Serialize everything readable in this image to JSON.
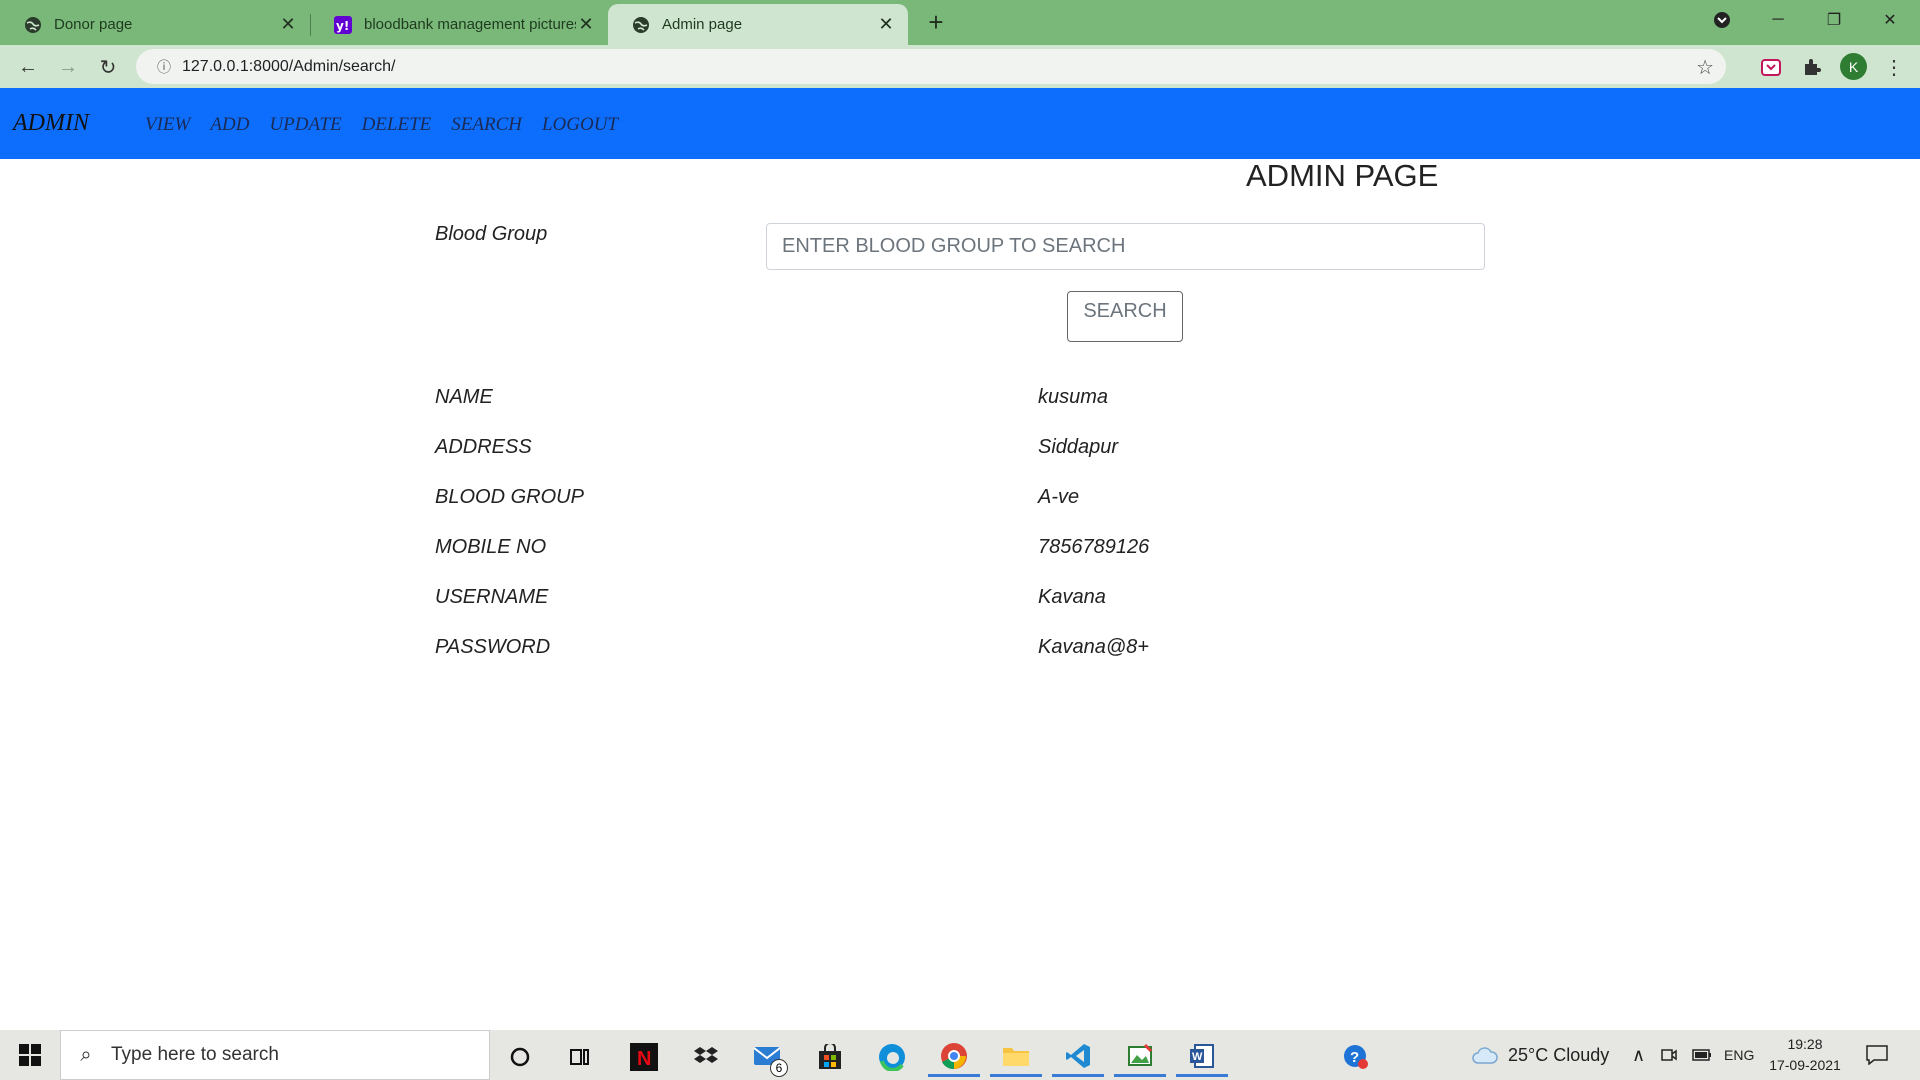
{
  "browser": {
    "tabs": [
      {
        "title": "Donor page",
        "icon": "globe-icon",
        "active": false
      },
      {
        "title": "bloodbank management pictures",
        "icon": "yahoo-icon",
        "active": false
      },
      {
        "title": "Admin page",
        "icon": "globe-icon",
        "active": true
      }
    ],
    "url": "127.0.0.1:8000/Admin/search/",
    "profile_initial": "K"
  },
  "navbar": {
    "brand": "ADMIN",
    "links": [
      "VIEW",
      "ADD",
      "UPDATE",
      "DELETE",
      "SEARCH",
      "LOGOUT"
    ],
    "color": "#0d6efd"
  },
  "page": {
    "title": "ADMIN PAGE",
    "search": {
      "label": "Blood Group",
      "placeholder": "ENTER BLOOD GROUP TO SEARCH",
      "button": "SEARCH"
    },
    "result": [
      {
        "label": "NAME",
        "value": "kusuma"
      },
      {
        "label": "ADDRESS",
        "value": "Siddapur"
      },
      {
        "label": "BLOOD GROUP",
        "value": "A-ve"
      },
      {
        "label": "MOBILE NO",
        "value": "7856789126"
      },
      {
        "label": "USERNAME",
        "value": "Kavana"
      },
      {
        "label": "PASSWORD",
        "value": "Kavana@8+"
      }
    ]
  },
  "taskbar": {
    "search_placeholder": "Type here to search",
    "mail_badge": "6",
    "weather": "25°C  Cloudy",
    "language": "ENG",
    "time": "19:28",
    "date": "17-09-2021"
  }
}
